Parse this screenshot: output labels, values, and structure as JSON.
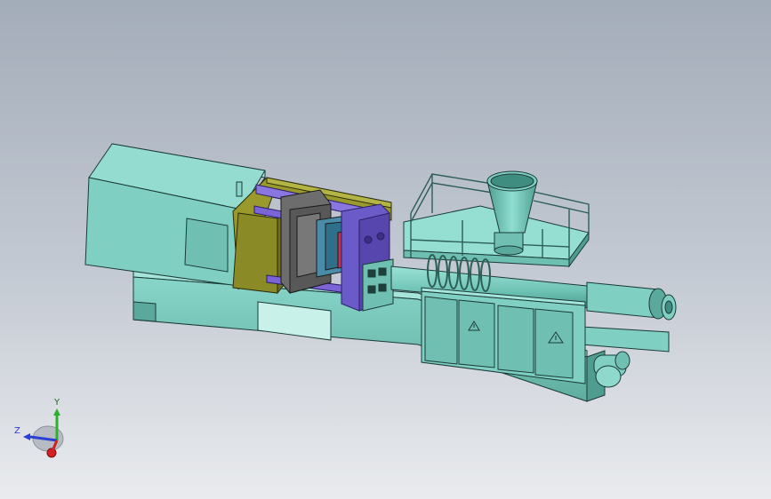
{
  "viewport": {
    "background_top": "#a3acb9",
    "background_bottom": "#e9ebee"
  },
  "model": {
    "colors": {
      "body": "#7fcfc2",
      "body_dark": "#5aa99c",
      "body_light": "#a5e6dc",
      "guard": "#8a8a26",
      "tie_bar": "#7a64d6",
      "platen": "#6b5bc8",
      "mould": "#6d6d6d",
      "mould_hot": "#c0334a",
      "edge": "#1b3a36"
    },
    "icons": [
      "warning-icon",
      "warning-icon"
    ]
  },
  "triad": {
    "y_label": "Y",
    "z_label": "Z",
    "x_color": "#d32020",
    "y_color": "#2db02d",
    "z_color": "#2a3fd6"
  }
}
